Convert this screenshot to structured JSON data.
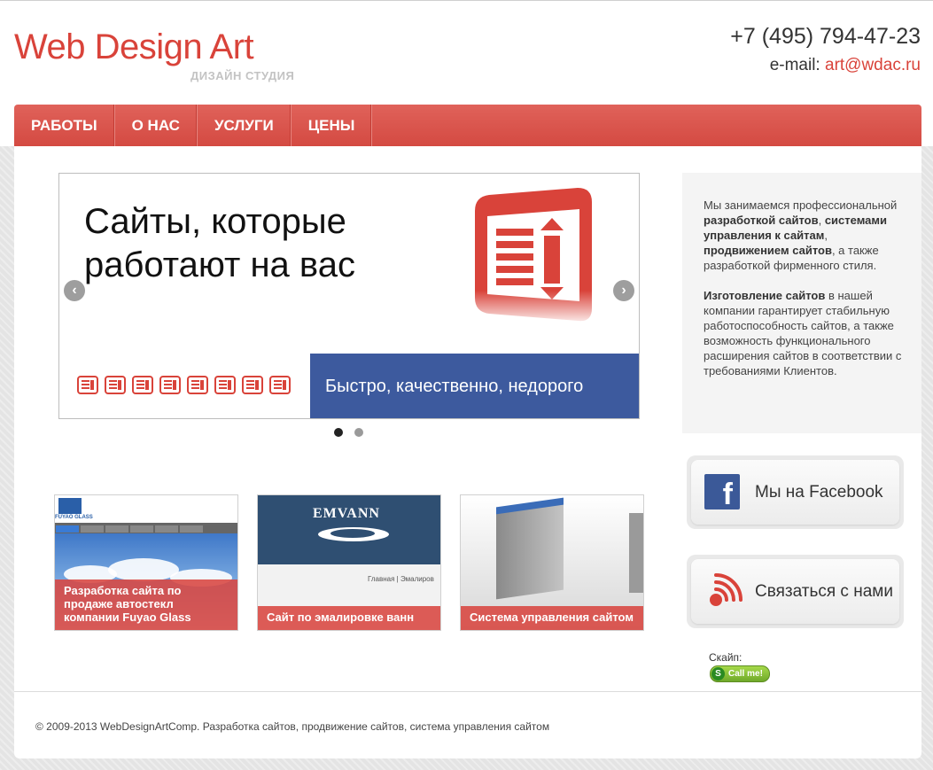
{
  "header": {
    "logo_title": "Web Design Art",
    "logo_subtitle": "ДИЗАЙН СТУДИЯ",
    "phone": "+7 (495) 794-47-23",
    "email_label": "e-mail:",
    "email": "art@wdac.ru"
  },
  "nav": {
    "items": [
      {
        "label": "РАБОТЫ"
      },
      {
        "label": "О НАС"
      },
      {
        "label": "УСЛУГИ"
      },
      {
        "label": "ЦЕНЫ"
      }
    ]
  },
  "slider": {
    "headline_line1": "Сайты, которые",
    "headline_line2": "работают на вас",
    "tagline": "Быстро, качественно, недорого",
    "prev_icon": "chevron-left",
    "next_icon": "chevron-right",
    "dots": 2,
    "active_dot": 1,
    "accent_color": "#d9433a",
    "tagline_bg": "#3d5a9e"
  },
  "about": {
    "p1_a": "Мы занимаемся профессиональной ",
    "p1_b": "разработкой сайтов",
    "p1_c": ", ",
    "p1_d": "системами управления к сайтам",
    "p1_e": ", ",
    "p1_f": "продвижением сайтов",
    "p1_g": ", а также разработкой фирменного стиля.",
    "p2_a": "Изготовление сайтов",
    "p2_b": " в нашей компании гарантирует стабильную работоспособность сайтов, а также возможность функционального расширения сайтов в соответствии с требованиями Клиентов."
  },
  "sidebar": {
    "facebook_label": "Мы на Facebook",
    "contact_label": "Связаться с нами",
    "skype_label": "Скайп:",
    "skype_button": "Call me!"
  },
  "portfolio": [
    {
      "caption": "Разработка сайта по продаже автостекл компании Fuyao Glass",
      "thumb_text": "FUYAO GLASS"
    },
    {
      "caption": "Сайт по эмалировке ванн",
      "thumb_text": "EMVANN",
      "thumb_nav": "Главная  |  Эмалиров"
    },
    {
      "caption": "Система управления сайтом"
    }
  ],
  "footer": {
    "copyright": "© 2009-2013 WebDesignArtComp. Разработка сайтов, продвижение сайтов, система управления сайтом"
  },
  "colors": {
    "brand_red": "#d9433a",
    "facebook_blue": "#3b5998"
  }
}
